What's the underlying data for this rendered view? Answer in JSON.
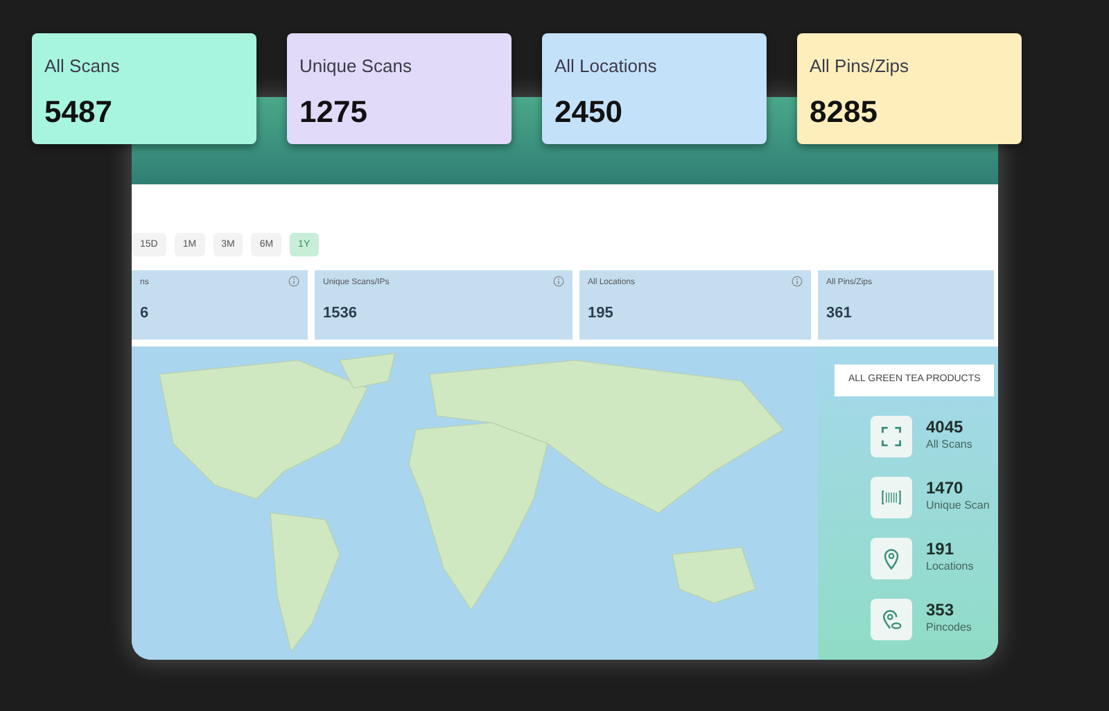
{
  "summary_cards": [
    {
      "label": "All Scans",
      "value": "5487",
      "color": "#a8f5df"
    },
    {
      "label": "Unique Scans",
      "value": "1275",
      "color": "#e2daf9"
    },
    {
      "label": "All Locations",
      "value": "2450",
      "color": "#c4e1fa"
    },
    {
      "label": "All Pins/Zips",
      "value": "8285",
      "color": "#fdeebb"
    }
  ],
  "periods": [
    {
      "label": "15D",
      "selected": false
    },
    {
      "label": "1M",
      "selected": false
    },
    {
      "label": "3M",
      "selected": false
    },
    {
      "label": "6M",
      "selected": false
    },
    {
      "label": "1Y",
      "selected": true
    }
  ],
  "stat_cards": [
    {
      "label": "ns",
      "value": "6",
      "info": true
    },
    {
      "label": "Unique Scans/IPs",
      "value": "1536",
      "info": true
    },
    {
      "label": "All Locations",
      "value": "195",
      "info": true
    },
    {
      "label": "All Pins/Zips",
      "value": "361",
      "info": false
    }
  ],
  "side_panel": {
    "filter": "ALL GREEN TEA PRODUCTS",
    "metrics": [
      {
        "kind": "scan",
        "value": "4045",
        "label": "All Scans"
      },
      {
        "kind": "barcode",
        "value": "1470",
        "label": "Unique Scan"
      },
      {
        "kind": "pin",
        "value": "191",
        "label": "Locations"
      },
      {
        "kind": "pincode",
        "value": "353",
        "label": "Pincodes"
      }
    ]
  }
}
